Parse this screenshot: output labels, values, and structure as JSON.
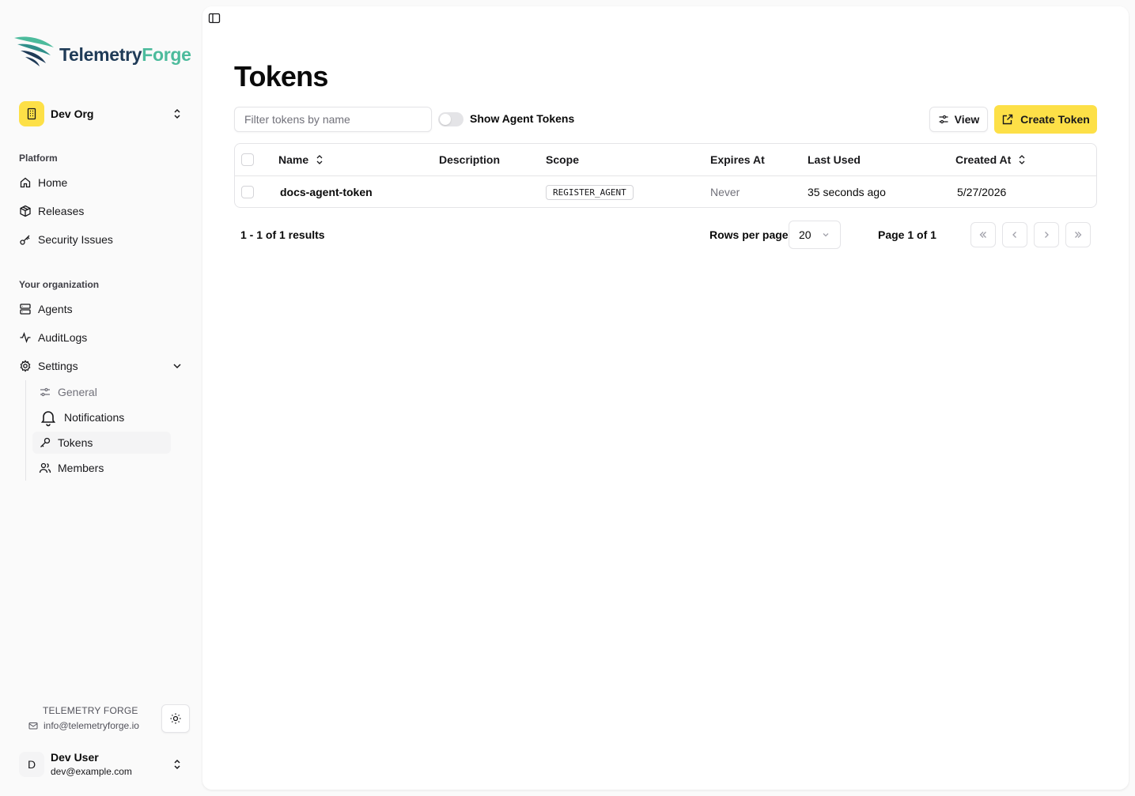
{
  "brand": {
    "name_part1": "Telemetry",
    "name_part2": "Forge"
  },
  "org": {
    "name": "Dev Org"
  },
  "nav": {
    "platform_label": "Platform",
    "platform_items": [
      {
        "label": "Home",
        "icon": "home-icon"
      },
      {
        "label": "Releases",
        "icon": "package-icon"
      },
      {
        "label": "Security Issues",
        "icon": "key-icon"
      }
    ],
    "org_label": "Your organization",
    "org_items": [
      {
        "label": "Agents",
        "icon": "server-icon"
      },
      {
        "label": "AuditLogs",
        "icon": "activity-icon"
      },
      {
        "label": "Settings",
        "icon": "gear-icon"
      }
    ],
    "settings_items": [
      {
        "label": "General",
        "icon": "sliders-icon"
      },
      {
        "label": "Notifications",
        "icon": "bell-icon"
      },
      {
        "label": "Tokens",
        "icon": "key-icon"
      },
      {
        "label": "Members",
        "icon": "users-icon"
      }
    ]
  },
  "footer": {
    "brand_name": "TELEMETRY FORGE",
    "brand_email": "info@telemetryforge.io",
    "user_initial": "D",
    "user_name": "Dev User",
    "user_email": "dev@example.com"
  },
  "page": {
    "title": "Tokens",
    "filter_placeholder": "Filter tokens by name",
    "toggle_label": "Show Agent Tokens",
    "view_label": "View",
    "create_label": "Create Token"
  },
  "table": {
    "columns": {
      "name": "Name",
      "description": "Description",
      "scope": "Scope",
      "expires": "Expires At",
      "last_used": "Last Used",
      "created": "Created At"
    },
    "rows": [
      {
        "name": "docs-agent-token",
        "description": "",
        "scope": "REGISTER_AGENT",
        "expires": "Never",
        "last_used": "35 seconds ago",
        "created": "5/27/2026"
      }
    ]
  },
  "pagination": {
    "results": "1 - 1 of 1 results",
    "rows_per_page_label": "Rows per page",
    "rows_per_page_value": "20",
    "page_info": "Page 1 of 1"
  }
}
